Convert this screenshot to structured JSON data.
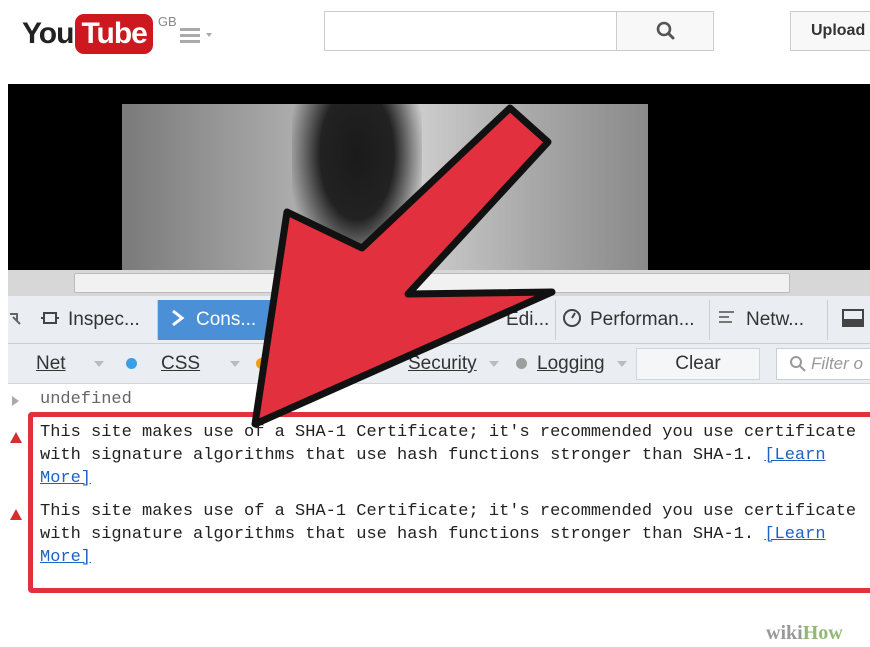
{
  "header": {
    "logo_you": "You",
    "logo_tube": "Tube",
    "country": "GB",
    "search_placeholder": "",
    "upload_label": "Upload"
  },
  "devtools": {
    "tabs": [
      {
        "label": "Inspec...",
        "icon": "inspector-icon"
      },
      {
        "label": "Cons...",
        "icon": "console-icon"
      },
      {
        "label": "Edi...",
        "icon": "style-editor-icon"
      },
      {
        "label": "Performan...",
        "icon": "performance-icon"
      },
      {
        "label": "Netw...",
        "icon": "network-icon"
      }
    ],
    "filters": {
      "net": "Net",
      "css": "CSS",
      "security": "Security",
      "logging": "Logging",
      "clear": "Clear",
      "filter_placeholder": "Filter o"
    },
    "colors": {
      "css_dot": "#39a0e5",
      "js_dot": "#f39c12",
      "logging_dot": "#9e9e9e",
      "active_tab": "#4b8fd6",
      "highlight": "#e2303f",
      "arrow": "#e2303f"
    }
  },
  "console": {
    "undefined_line": "undefined",
    "messages": [
      {
        "text": "This site makes use of a SHA-1 Certificate; it's recommended you use certificate\nwith signature algorithms that use hash functions stronger than SHA-1. ",
        "link": "[Learn\nMore]"
      },
      {
        "text": "This site makes use of a SHA-1 Certificate; it's recommended you use certificate\nwith signature algorithms that use hash functions stronger than SHA-1. ",
        "link": "[Learn\nMore]"
      }
    ]
  },
  "watermark": {
    "wiki": "wiki",
    "how": "How"
  }
}
